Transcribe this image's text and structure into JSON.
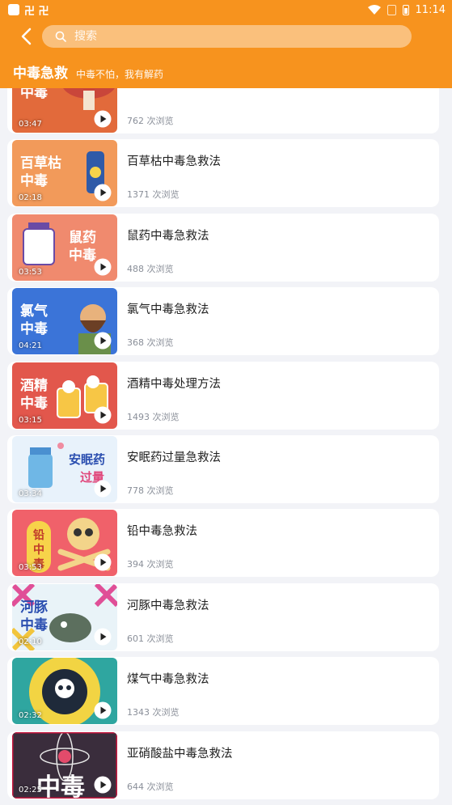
{
  "status_bar": {
    "carrier_icons": "卍 卍",
    "time": "11:14"
  },
  "header": {
    "search_placeholder": "搜索",
    "title": "中毒急救",
    "subtitle": "中毒不怕，我有解药"
  },
  "videos": [
    {
      "thumb_text": "毒蘑菇 中毒",
      "duration": "03:47",
      "title": "",
      "views": "762 次浏览",
      "bg": "#e26a3b"
    },
    {
      "thumb_text": "百草枯 中毒",
      "duration": "02:18",
      "title": "百草枯中毒急救法",
      "views": "1371 次浏览",
      "bg": "#f29a5a"
    },
    {
      "thumb_text": "鼠药 中毒",
      "duration": "03:53",
      "title": "鼠药中毒急救法",
      "views": "488 次浏览",
      "bg": "#f08a6e"
    },
    {
      "thumb_text": "氯气 中毒",
      "duration": "04:21",
      "title": "氯气中毒急救法",
      "views": "368 次浏览",
      "bg": "#3b74d8"
    },
    {
      "thumb_text": "酒精 中毒",
      "duration": "03:15",
      "title": "酒精中毒处理方法",
      "views": "1493 次浏览",
      "bg": "#e2574c"
    },
    {
      "thumb_text": "安眠药 过量",
      "duration": "03:34",
      "title": "安眠药过量急救法",
      "views": "778 次浏览",
      "bg": "#e8f2fb"
    },
    {
      "thumb_text": "铅 中 毒",
      "duration": "03:53",
      "title": "铅中毒急救法",
      "views": "394 次浏览",
      "bg": "#f0616a"
    },
    {
      "thumb_text": "河豚 中毒",
      "duration": "02:10",
      "title": "河豚中毒急救法",
      "views": "601 次浏览",
      "bg": "#e9f3f8"
    },
    {
      "thumb_text": "",
      "duration": "02:32",
      "title": "煤气中毒急救法",
      "views": "1343 次浏览",
      "bg": "#2fa6a0"
    },
    {
      "thumb_text": "中毒",
      "duration": "02:25",
      "title": "亚硝酸盐中毒急救法",
      "views": "644 次浏览",
      "bg": "#3a2d3c"
    }
  ]
}
